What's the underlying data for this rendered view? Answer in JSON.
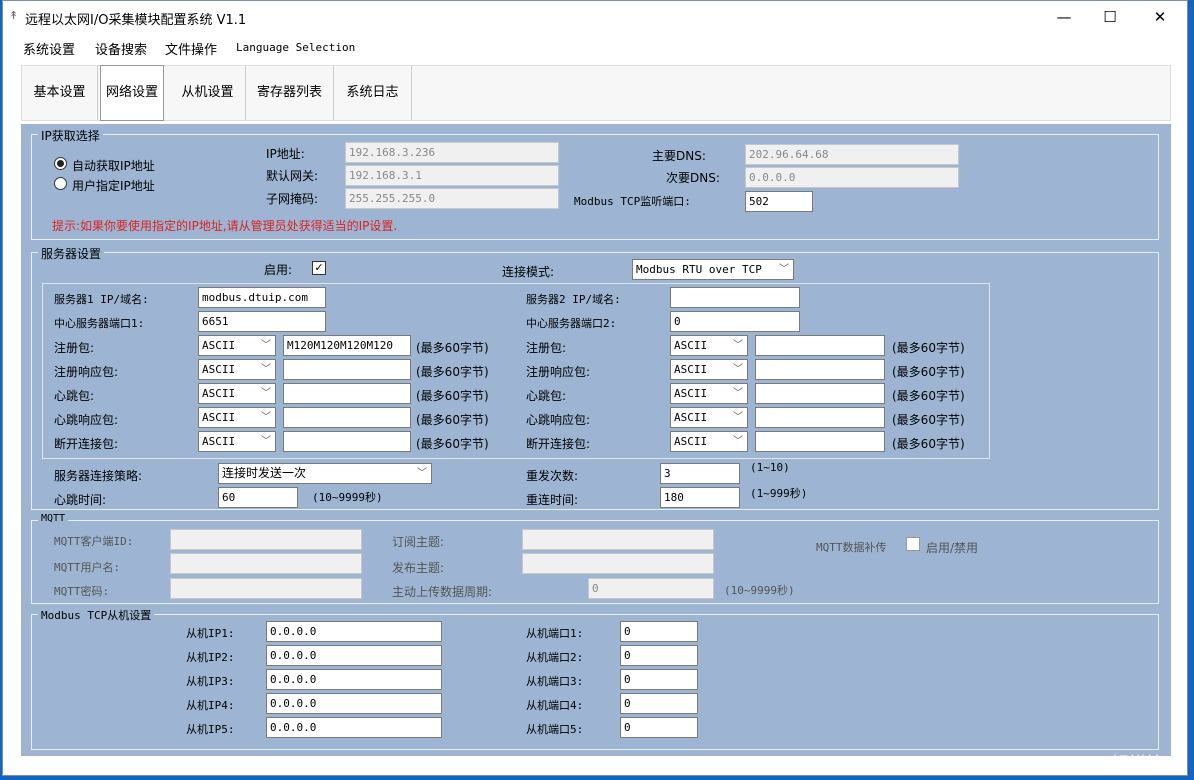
{
  "window": {
    "title": "远程以太网I/O采集模块配置系统 V1.1",
    "icon": "app-icon",
    "minimize": "—",
    "maximize": "☐",
    "close": "✕"
  },
  "menu": [
    "系统设置",
    "设备搜索",
    "文件操作",
    "Language Selection"
  ],
  "tabs": [
    "基本设置",
    "网络设置",
    "从机设置",
    "寄存器列表",
    "系统日志"
  ],
  "ip": {
    "group_title": "IP获取选择",
    "auto": "自动获取IP地址",
    "manual": "用户指定IP地址",
    "ip_label": "IP地址:",
    "ip_value": "192.168.3.236",
    "gw_label": "默认网关:",
    "gw_value": "192.168.3.1",
    "mask_label": "子网掩码:",
    "mask_value": "255.255.255.0",
    "dns1_label": "主要DNS:",
    "dns1_value": "202.96.64.68",
    "dns2_label": "次要DNS:",
    "dns2_value": "0.0.0.0",
    "port_label": "Modbus TCP监听端口:",
    "port_value": "502",
    "hint": "提示:如果你要使用指定的IP地址,请从管理员处获得适当的IP设置."
  },
  "server": {
    "group_title": "服务器设置",
    "enable_label": "启用:",
    "enable_check": "✓",
    "mode_label": "连接模式:",
    "mode_value": "Modbus RTU over TCP",
    "s1": {
      "addr_label": "服务器1 IP/域名:",
      "addr_value": "modbus.dtuip.com",
      "port_label": "中心服务器端口1:",
      "port_value": "6651"
    },
    "s2": {
      "addr_label": "服务器2 IP/域名:",
      "addr_value": "",
      "port_label": "中心服务器端口2:",
      "port_value": "0"
    },
    "packets": [
      {
        "label": "注册包:",
        "enc": "ASCII",
        "value1": "M120M120M120M120",
        "value2": ""
      },
      {
        "label": "注册响应包:",
        "enc": "ASCII",
        "value1": "",
        "value2": ""
      },
      {
        "label": "心跳包:",
        "enc": "ASCII",
        "value1": "",
        "value2": ""
      },
      {
        "label": "心跳响应包:",
        "enc": "ASCII",
        "value1": "",
        "value2": ""
      },
      {
        "label": "断开连接包:",
        "enc": "ASCII",
        "value1": "",
        "value2": ""
      }
    ],
    "max_note": "(最多60字节)",
    "strategy_label": "服务器连接策略:",
    "strategy_value": "连接时发送一次",
    "heartbeat_label": "心跳时间:",
    "heartbeat_value": "60",
    "heartbeat_range": "(10~9999秒)",
    "retry_label": "重发次数:",
    "retry_value": "3",
    "retry_range": "(1~10)",
    "reconnect_label": "重连时间:",
    "reconnect_value": "180",
    "reconnect_range": "(1~999秒)"
  },
  "mqtt": {
    "group_title": "MQTT",
    "client_label": "MQTT客户端ID:",
    "user_label": "MQTT用户名:",
    "pass_label": "MQTT密码:",
    "sub_label": "订阅主题:",
    "pub_label": "发布主题:",
    "period_label": "主动上传数据周期:",
    "period_value": "0",
    "period_range": "(10~9999秒)",
    "resend_label": "MQTT数据补传",
    "resend_toggle": "启用/禁用"
  },
  "slave": {
    "group_title": "Modbus TCP从机设置",
    "rows": [
      {
        "ip_label": "从机IP1:",
        "ip": "0.0.0.0",
        "port_label": "从机端口1:",
        "port": "0"
      },
      {
        "ip_label": "从机IP2:",
        "ip": "0.0.0.0",
        "port_label": "从机端口2:",
        "port": "0"
      },
      {
        "ip_label": "从机IP3:",
        "ip": "0.0.0.0",
        "port_label": "从机端口3:",
        "port": "0"
      },
      {
        "ip_label": "从机IP4:",
        "ip": "0.0.0.0",
        "port_label": "从机端口4:",
        "port": "0"
      },
      {
        "ip_label": "从机IP5:",
        "ip": "0.0.0.0",
        "port_label": "从机端口5:",
        "port": "0"
      }
    ]
  },
  "watermark": "CSDN @钡镁技术"
}
